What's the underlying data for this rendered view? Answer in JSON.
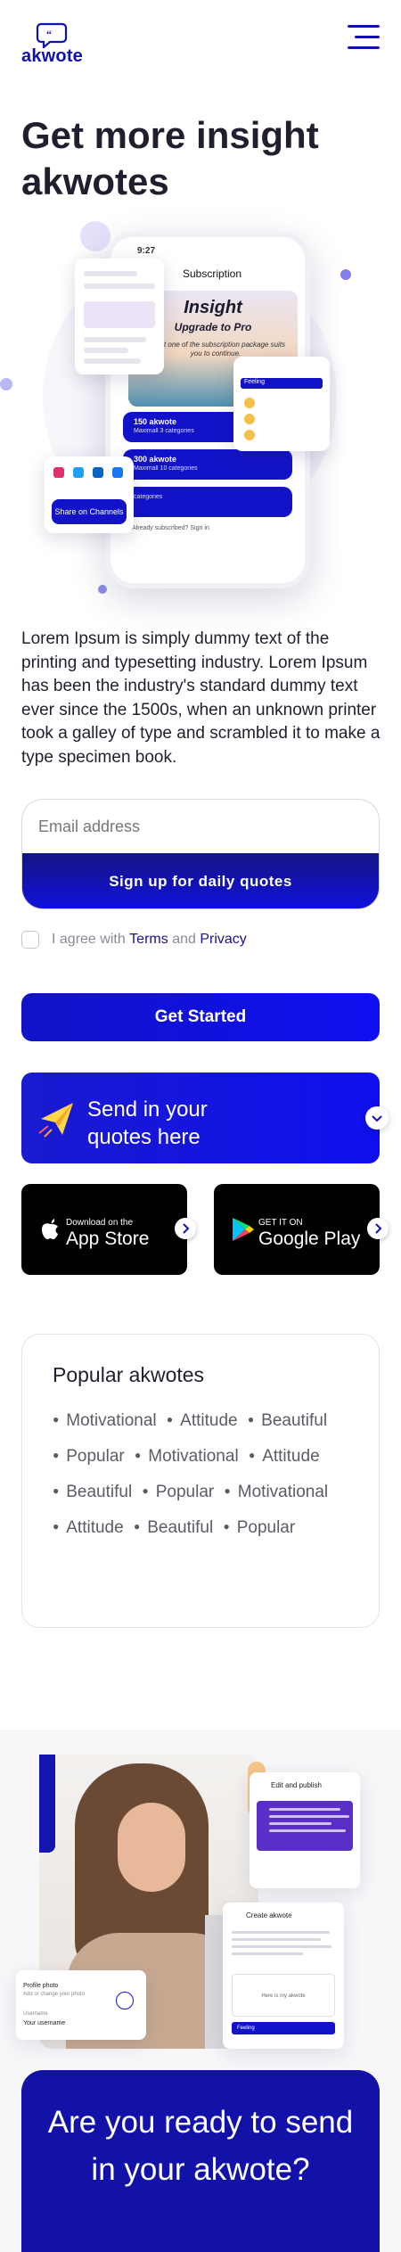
{
  "header": {
    "logo_text": "akwote",
    "logo_icon": "speech-bubble-icon",
    "menu_icon": "hamburger-menu-icon"
  },
  "hero": {
    "title": "Get more insight akwotes",
    "phone": {
      "time": "9:27",
      "screen_title": "Subscription",
      "headline": "Insight",
      "subheadline": "Upgrade to Pro",
      "description": "Select one of the subscription package suits you to continue.",
      "plans": [
        {
          "title": "150 akwote",
          "detail": "Maximall 3 categories"
        },
        {
          "title": "300 akwote",
          "detail": "Maximall 10 categories"
        },
        {
          "title": "",
          "detail": "categories"
        }
      ],
      "footer": "Already subscribed? Sign in."
    },
    "share_button": "Share on Channels",
    "feeling_label": "Feeling"
  },
  "intro": {
    "text": "Lorem Ipsum is simply dummy text of the printing and typesetting industry. Lorem Ipsum has been the industry's standard dummy text ever since the 1500s, when an unknown printer took a galley of type and scrambled it to make a type specimen book."
  },
  "signup": {
    "email_placeholder": "Email address",
    "button_label": "Sign up for daily quotes"
  },
  "agree": {
    "prefix": "I agree with",
    "terms": "Terms",
    "and": "and",
    "privacy": "Privacy"
  },
  "get_started": {
    "label": "Get Started"
  },
  "send_banner": {
    "line1": "Send in your",
    "line2": "quotes here"
  },
  "stores": {
    "apple": {
      "small": "Download on the",
      "big": "App Store"
    },
    "google": {
      "small": "GET IT ON",
      "big": "Google Play"
    }
  },
  "popular": {
    "title": "Popular akwotes",
    "tags": [
      "Motivational",
      "Attitude",
      "Beautiful",
      "Popular",
      "Motivational",
      "Attitude",
      "Beautiful",
      "Popular",
      "Motivational",
      "Attitude",
      "Beautiful",
      "Popular"
    ]
  },
  "showcase": {
    "edit_title": "Edit and publish",
    "create_title": "Create akwote",
    "create_box": "Here is my akwote",
    "create_select": "Feeling",
    "profile_photo": "Profile photo",
    "profile_hint": "Add or change your photo",
    "username_label": "Username",
    "username_value": "Your username"
  },
  "cta": {
    "title": "Are you ready to send in your akwote?"
  },
  "colors": {
    "brand_blue": "#1010b8",
    "button_blue": "#1212c8",
    "cta_blue": "#1212a8",
    "text_dark": "#1f1f2e",
    "muted": "#8a8a96"
  }
}
